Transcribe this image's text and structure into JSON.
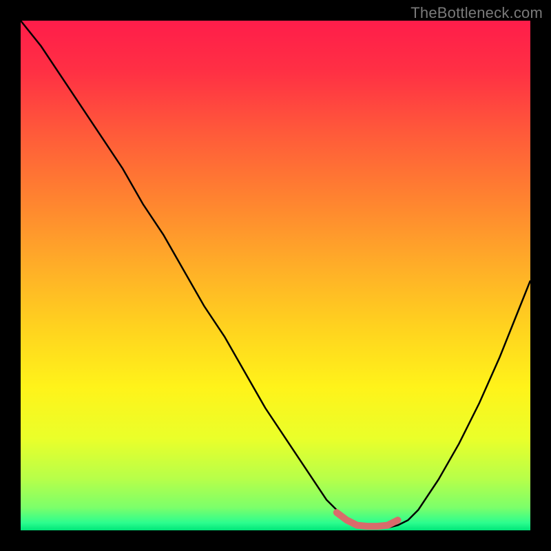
{
  "watermark": "TheBottleneck.com",
  "colors": {
    "frame_bg": "#000000",
    "curve_stroke": "#000000",
    "marker_stroke": "#d96b6b"
  },
  "chart_data": {
    "type": "line",
    "title": "",
    "xlabel": "",
    "ylabel": "",
    "xlim": [
      0,
      100
    ],
    "ylim": [
      0,
      100
    ],
    "gradient_stops": [
      {
        "offset": 0.0,
        "color": "#ff1d4a"
      },
      {
        "offset": 0.1,
        "color": "#ff3044"
      },
      {
        "offset": 0.22,
        "color": "#ff5a3a"
      },
      {
        "offset": 0.35,
        "color": "#ff8330"
      },
      {
        "offset": 0.48,
        "color": "#ffad28"
      },
      {
        "offset": 0.6,
        "color": "#ffd21f"
      },
      {
        "offset": 0.72,
        "color": "#fff31a"
      },
      {
        "offset": 0.82,
        "color": "#eaff2a"
      },
      {
        "offset": 0.9,
        "color": "#b6ff4a"
      },
      {
        "offset": 0.955,
        "color": "#7cff6a"
      },
      {
        "offset": 0.985,
        "color": "#2dfd8e"
      },
      {
        "offset": 1.0,
        "color": "#00e67a"
      }
    ],
    "series": [
      {
        "name": "bottleneck-curve",
        "x": [
          0,
          4,
          8,
          12,
          16,
          20,
          24,
          28,
          32,
          36,
          40,
          44,
          48,
          52,
          56,
          60,
          62,
          64,
          66,
          68,
          70,
          72,
          74,
          76,
          78,
          82,
          86,
          90,
          94,
          98,
          100
        ],
        "y": [
          100,
          95,
          89,
          83,
          77,
          71,
          64,
          58,
          51,
          44,
          38,
          31,
          24,
          18,
          12,
          6,
          4,
          2,
          1,
          0.5,
          0.5,
          0.5,
          1,
          2,
          4,
          10,
          17,
          25,
          34,
          44,
          49
        ]
      }
    ],
    "marker": {
      "name": "optimal-range",
      "x": [
        62,
        64,
        66,
        68,
        70,
        72,
        74
      ],
      "y": [
        3.5,
        2,
        1,
        0.8,
        0.8,
        1,
        2
      ]
    }
  }
}
